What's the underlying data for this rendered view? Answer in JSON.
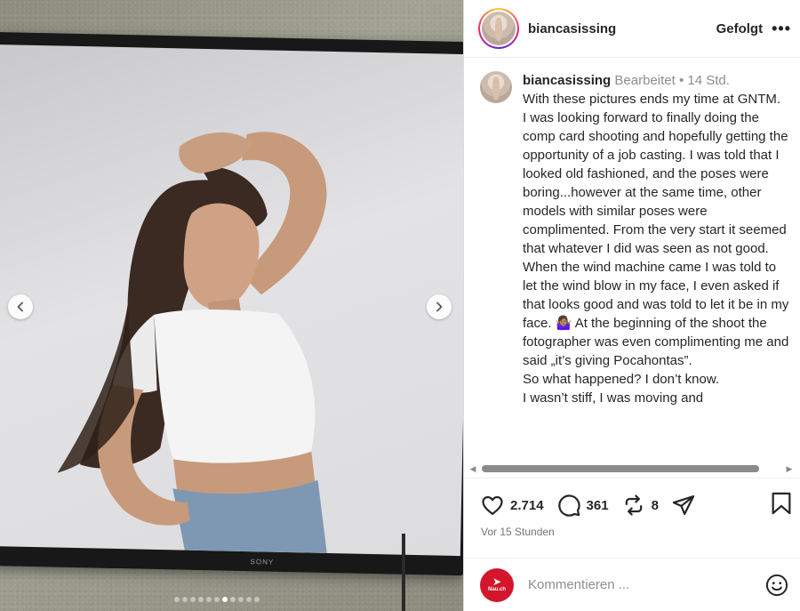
{
  "media": {
    "tv_brand": "SONY",
    "carousel_total": 11,
    "carousel_active_index": 6
  },
  "post": {
    "username": "biancasissing",
    "follow_label": "Gefolgt",
    "more_label": "•••",
    "caption": {
      "username": "biancasissing",
      "edited_label": "Bearbeitet",
      "separator": " • ",
      "time_ago": "14 Std.",
      "lines": [
        "With these pictures ends my time at GNTM.",
        "I was looking forward to finally doing the comp card shooting and hopefully getting the opportunity of a job casting. I was told that I looked old fashioned, and the poses were boring...however at the same time, other models with similar poses were complimented. From the very start it seemed that whatever I did was seen as not good. When the wind machine came I was told to let the wind blow in my face, I even asked if that looks good and was told to let it be in my face. 🤷🏽‍♀️ At the beginning of the shoot the fotographer was even complimenting me and said „it’s giving Pocahontas”.",
        "So what happened? I don’t know.",
        "I wasn’t stiff, I was moving and"
      ]
    },
    "likes": "2.714",
    "comments": "361",
    "reposts": "8",
    "timestamp": "Vor 15 Stunden",
    "comment_placeholder": "Kommentieren ...",
    "commenter_brand": "Nau.ch"
  },
  "icons": {
    "like": "heart-icon",
    "comment": "comment-bubble-icon",
    "repost": "repost-icon",
    "share": "send-icon",
    "save": "bookmark-icon",
    "emoji": "smiley-icon",
    "prev": "chevron-left-icon",
    "next": "chevron-right-icon"
  },
  "colors": {
    "text": "#262626",
    "muted": "#8e8e8e",
    "brand_red": "#d3162b"
  }
}
